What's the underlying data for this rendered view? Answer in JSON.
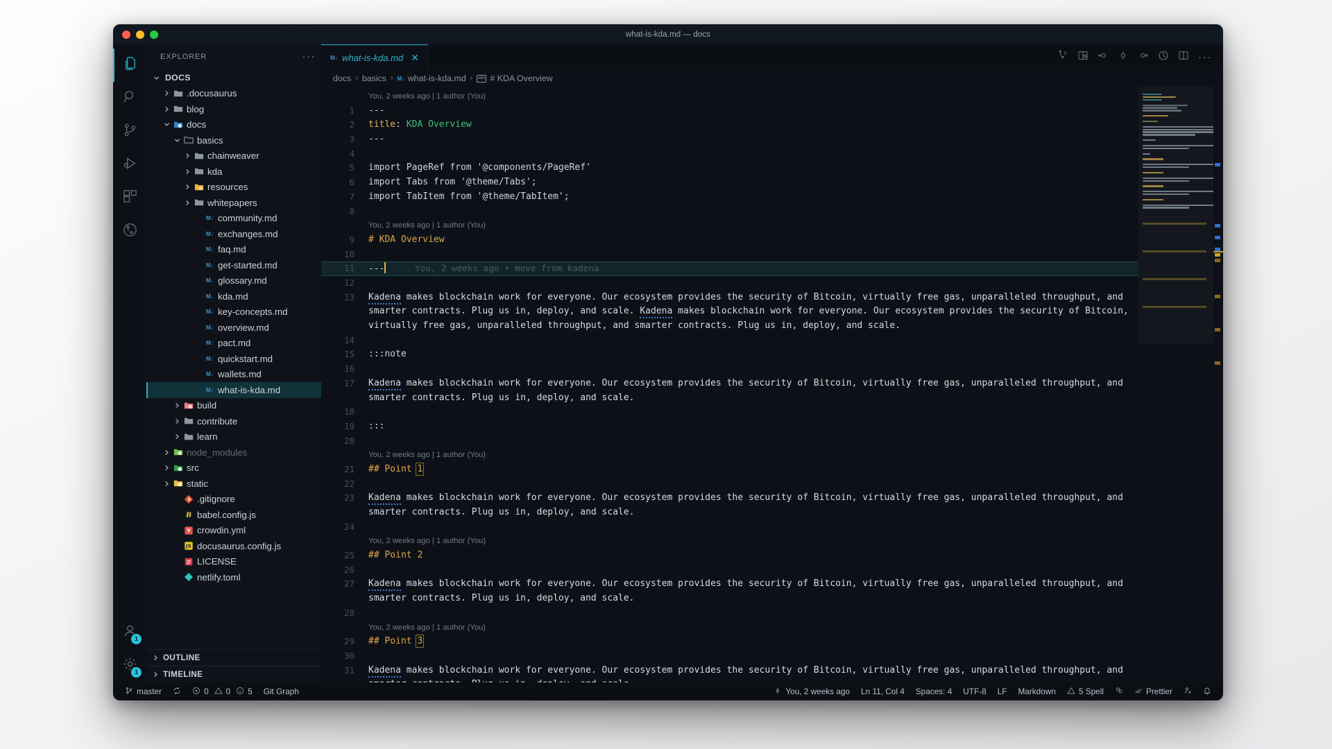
{
  "window": {
    "title": "what-is-kda.md — docs"
  },
  "traffic_lights": [
    "close",
    "minimize",
    "zoom"
  ],
  "activity_bar": {
    "items": [
      {
        "name": "explorer",
        "icon": "files-icon",
        "active": true,
        "badge": null
      },
      {
        "name": "search",
        "icon": "search-icon",
        "active": false,
        "badge": null
      },
      {
        "name": "source-control",
        "icon": "source-control-icon",
        "active": false,
        "badge": null
      },
      {
        "name": "run-debug",
        "icon": "run-debug-icon",
        "active": false,
        "badge": null
      },
      {
        "name": "extensions",
        "icon": "extensions-icon",
        "active": false,
        "badge": null
      },
      {
        "name": "git-graph",
        "icon": "git-graph-icon",
        "active": false,
        "badge": null
      }
    ],
    "bottom": [
      {
        "name": "accounts",
        "icon": "account-icon",
        "badge": "1"
      },
      {
        "name": "settings",
        "icon": "gear-icon",
        "badge": "1"
      }
    ],
    "active_color": "#25c2d6"
  },
  "sidebar": {
    "title": "EXPLORER",
    "more_actions": "···",
    "tree": [
      {
        "label": "DOCS",
        "indent": 0,
        "type": "root",
        "chevron": "down",
        "icon": "none",
        "selected": false,
        "dim": false
      },
      {
        "label": ".docusaurus",
        "indent": 1,
        "type": "folder",
        "chevron": "right",
        "icon": "folder-gray",
        "selected": false,
        "dim": false
      },
      {
        "label": "blog",
        "indent": 1,
        "type": "folder",
        "chevron": "right",
        "icon": "folder-gray",
        "selected": false,
        "dim": false
      },
      {
        "label": "docs",
        "indent": 1,
        "type": "folder",
        "chevron": "down",
        "icon": "folder-docs",
        "selected": false,
        "dim": false
      },
      {
        "label": "basics",
        "indent": 2,
        "type": "folder",
        "chevron": "down",
        "icon": "folder-open",
        "selected": false,
        "dim": false
      },
      {
        "label": "chainweaver",
        "indent": 3,
        "type": "folder",
        "chevron": "right",
        "icon": "folder-gray",
        "selected": false,
        "dim": false
      },
      {
        "label": "kda",
        "indent": 3,
        "type": "folder",
        "chevron": "right",
        "icon": "folder-gray",
        "selected": false,
        "dim": false
      },
      {
        "label": "resources",
        "indent": 3,
        "type": "folder",
        "chevron": "right",
        "icon": "folder-yellow",
        "selected": false,
        "dim": false
      },
      {
        "label": "whitepapers",
        "indent": 3,
        "type": "folder",
        "chevron": "right",
        "icon": "folder-gray",
        "selected": false,
        "dim": false
      },
      {
        "label": "community.md",
        "indent": 4,
        "type": "file",
        "chevron": "none",
        "icon": "markdown-icon",
        "selected": false,
        "dim": false
      },
      {
        "label": "exchanges.md",
        "indent": 4,
        "type": "file",
        "chevron": "none",
        "icon": "markdown-icon",
        "selected": false,
        "dim": false
      },
      {
        "label": "faq.md",
        "indent": 4,
        "type": "file",
        "chevron": "none",
        "icon": "markdown-icon",
        "selected": false,
        "dim": false
      },
      {
        "label": "get-started.md",
        "indent": 4,
        "type": "file",
        "chevron": "none",
        "icon": "markdown-icon",
        "selected": false,
        "dim": false
      },
      {
        "label": "glossary.md",
        "indent": 4,
        "type": "file",
        "chevron": "none",
        "icon": "markdown-icon",
        "selected": false,
        "dim": false
      },
      {
        "label": "kda.md",
        "indent": 4,
        "type": "file",
        "chevron": "none",
        "icon": "markdown-icon",
        "selected": false,
        "dim": false
      },
      {
        "label": "key-concepts.md",
        "indent": 4,
        "type": "file",
        "chevron": "none",
        "icon": "markdown-icon",
        "selected": false,
        "dim": false
      },
      {
        "label": "overview.md",
        "indent": 4,
        "type": "file",
        "chevron": "none",
        "icon": "markdown-icon",
        "selected": false,
        "dim": false
      },
      {
        "label": "pact.md",
        "indent": 4,
        "type": "file",
        "chevron": "none",
        "icon": "markdown-icon",
        "selected": false,
        "dim": false
      },
      {
        "label": "quickstart.md",
        "indent": 4,
        "type": "file",
        "chevron": "none",
        "icon": "markdown-icon",
        "selected": false,
        "dim": false
      },
      {
        "label": "wallets.md",
        "indent": 4,
        "type": "file",
        "chevron": "none",
        "icon": "markdown-icon",
        "selected": false,
        "dim": false
      },
      {
        "label": "what-is-kda.md",
        "indent": 4,
        "type": "file",
        "chevron": "none",
        "icon": "markdown-icon",
        "selected": true,
        "dim": false
      },
      {
        "label": "build",
        "indent": 2,
        "type": "folder",
        "chevron": "right",
        "icon": "folder-red",
        "selected": false,
        "dim": false
      },
      {
        "label": "contribute",
        "indent": 2,
        "type": "folder",
        "chevron": "right",
        "icon": "folder-gray",
        "selected": false,
        "dim": false
      },
      {
        "label": "learn",
        "indent": 2,
        "type": "folder",
        "chevron": "right",
        "icon": "folder-gray",
        "selected": false,
        "dim": false
      },
      {
        "label": "node_modules",
        "indent": 1,
        "type": "folder",
        "chevron": "right",
        "icon": "folder-node",
        "selected": false,
        "dim": true
      },
      {
        "label": "src",
        "indent": 1,
        "type": "folder",
        "chevron": "right",
        "icon": "folder-src",
        "selected": false,
        "dim": false
      },
      {
        "label": "static",
        "indent": 1,
        "type": "folder",
        "chevron": "right",
        "icon": "folder-static",
        "selected": false,
        "dim": false
      },
      {
        "label": ".gitignore",
        "indent": 2,
        "type": "file",
        "chevron": "none",
        "icon": "git-icon",
        "selected": false,
        "dim": false
      },
      {
        "label": "babel.config.js",
        "indent": 2,
        "type": "file",
        "chevron": "none",
        "icon": "babel-icon",
        "selected": false,
        "dim": false
      },
      {
        "label": "crowdin.yml",
        "indent": 2,
        "type": "file",
        "chevron": "none",
        "icon": "yaml-icon",
        "selected": false,
        "dim": false
      },
      {
        "label": "docusaurus.config.js",
        "indent": 2,
        "type": "file",
        "chevron": "none",
        "icon": "js-icon",
        "selected": false,
        "dim": false
      },
      {
        "label": "LICENSE",
        "indent": 2,
        "type": "file",
        "chevron": "none",
        "icon": "license-icon",
        "selected": false,
        "dim": false
      },
      {
        "label": "netlify.toml",
        "indent": 2,
        "type": "file",
        "chevron": "none",
        "icon": "netlify-icon",
        "selected": false,
        "dim": false
      }
    ],
    "panels": [
      {
        "label": "OUTLINE"
      },
      {
        "label": "TIMELINE"
      }
    ]
  },
  "editor": {
    "tab": {
      "label": "what-is-kda.md",
      "icon": "markdown-icon",
      "close": "✕",
      "active": true
    },
    "toolbar_icons": [
      "preview-split-icon",
      "open-preview-icon",
      "go-to-prev-change-icon",
      "go-to-change-icon",
      "go-to-next-change-icon",
      "toggle-blame-icon",
      "split-editor-icon",
      "more-actions-icon"
    ],
    "breadcrumb": [
      "docs",
      "basics",
      "what-is-kda.md",
      "# KDA Overview"
    ],
    "breadcrumb_file_icon": "markdown-icon",
    "breadcrumb_symbol_icon": "symbol-string-icon",
    "blame_text": "You, 2 weeks ago | 1 author (You)",
    "inline_blame": "You, 2 weeks ago • move from kadena",
    "paragraph_a": "Kadena makes blockchain work for everyone. Our ecosystem provides the security of Bitcoin, virtually free gas, unparalleled throughput, and smarter contracts. Plug us in, deploy, and scale.",
    "lines": [
      {
        "n": 1,
        "kind": "hr",
        "text": "---"
      },
      {
        "n": 2,
        "kind": "fm",
        "key": "title",
        "sep": ": ",
        "value": "KDA Overview"
      },
      {
        "n": 3,
        "kind": "hr",
        "text": "---"
      },
      {
        "n": 4,
        "kind": "blank",
        "text": ""
      },
      {
        "n": 5,
        "kind": "plain",
        "text": "import PageRef from '@components/PageRef'"
      },
      {
        "n": 6,
        "kind": "plain",
        "text": "import Tabs from '@theme/Tabs';"
      },
      {
        "n": 7,
        "kind": "plain",
        "text": "import TabItem from '@theme/TabItem';"
      },
      {
        "n": 8,
        "kind": "blank",
        "text": ""
      },
      {
        "n": 9,
        "kind": "heading",
        "text": "# KDA Overview"
      },
      {
        "n": 10,
        "kind": "blank",
        "text": ""
      },
      {
        "n": 11,
        "kind": "cursor",
        "text": "---"
      },
      {
        "n": 12,
        "kind": "blank",
        "text": ""
      },
      {
        "n": 13,
        "kind": "para",
        "repeat": 2
      },
      {
        "n": 14,
        "kind": "blank",
        "text": ""
      },
      {
        "n": 15,
        "kind": "plain",
        "text": ":::note"
      },
      {
        "n": 16,
        "kind": "blank",
        "text": ""
      },
      {
        "n": 17,
        "kind": "para",
        "repeat": 1
      },
      {
        "n": 18,
        "kind": "blank",
        "text": ""
      },
      {
        "n": 19,
        "kind": "plain",
        "text": ":::"
      },
      {
        "n": 20,
        "kind": "blank",
        "text": ""
      },
      {
        "n": 21,
        "kind": "heading-bracket",
        "text": "## Point ",
        "num": "1"
      },
      {
        "n": 22,
        "kind": "blank",
        "text": ""
      },
      {
        "n": 23,
        "kind": "para",
        "repeat": 1
      },
      {
        "n": 24,
        "kind": "blank",
        "text": ""
      },
      {
        "n": 25,
        "kind": "heading",
        "text": "## Point 2"
      },
      {
        "n": 26,
        "kind": "blank",
        "text": ""
      },
      {
        "n": 27,
        "kind": "para",
        "repeat": 1
      },
      {
        "n": 28,
        "kind": "blank",
        "text": ""
      },
      {
        "n": 29,
        "kind": "heading-bracket",
        "text": "## Point ",
        "num": "3"
      },
      {
        "n": 30,
        "kind": "blank",
        "text": ""
      },
      {
        "n": 31,
        "kind": "para-cut",
        "repeat": 1
      }
    ]
  },
  "statusbar": {
    "left": [
      {
        "name": "branch",
        "icon": "source-control-icon",
        "label": "master"
      },
      {
        "name": "sync",
        "icon": "sync-icon",
        "label": ""
      },
      {
        "name": "problems",
        "icon": "errors-icon",
        "label": "0  0  5",
        "errors": "0",
        "warnings": "0",
        "infos": "5"
      },
      {
        "name": "git-graph",
        "icon": "",
        "label": "Git Graph"
      }
    ],
    "right": [
      {
        "name": "blame",
        "icon": "git-commit-icon",
        "label": "You, 2 weeks ago"
      },
      {
        "name": "cursor-pos",
        "icon": "",
        "label": "Ln 11, Col 4"
      },
      {
        "name": "indentation",
        "icon": "",
        "label": "Spaces: 4"
      },
      {
        "name": "encoding",
        "icon": "",
        "label": "UTF-8"
      },
      {
        "name": "eol",
        "icon": "",
        "label": "LF"
      },
      {
        "name": "language",
        "icon": "",
        "label": "Markdown"
      },
      {
        "name": "spell",
        "icon": "warning-icon",
        "label": "5 Spell"
      },
      {
        "name": "hocus",
        "icon": "hocus-icon",
        "label": ""
      },
      {
        "name": "prettier",
        "icon": "check-icon",
        "label": "Prettier"
      },
      {
        "name": "remote",
        "icon": "broadcast-icon",
        "label": ""
      },
      {
        "name": "bell",
        "icon": "bell-icon",
        "label": ""
      }
    ]
  }
}
